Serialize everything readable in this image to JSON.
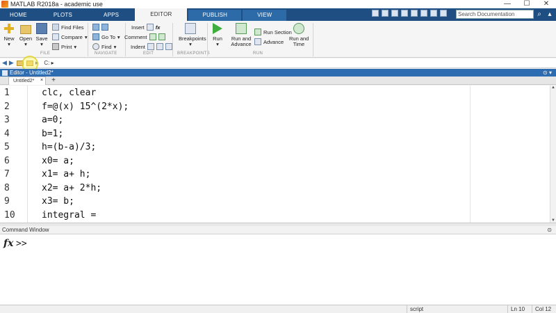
{
  "window": {
    "title": "MATLAB R2018a - academic use",
    "min": "—",
    "max": "☐",
    "close": "✕"
  },
  "tabs": [
    "HOME",
    "PLOTS",
    "APPS",
    "EDITOR",
    "PUBLISH",
    "VIEW"
  ],
  "search": {
    "placeholder": "Search Documentation"
  },
  "ribbon": {
    "new": "New",
    "open": "Open",
    "save": "Save",
    "find_files": "Find Files",
    "compare": "Compare",
    "print": "Print",
    "go_to": "Go To",
    "find": "Find",
    "insert": "Insert",
    "comment": "Comment",
    "indent": "Indent",
    "breakpoints": "Breakpoints",
    "run": "Run",
    "run_advance": "Run and\nAdvance",
    "run_section": "Run Section",
    "advance": "Advance",
    "run_time": "Run and\nTime",
    "sections": {
      "file": "FILE",
      "navigate": "NAVIGATE",
      "edit": "EDIT",
      "breakpoints": "BREAKPOINTS",
      "run": "RUN"
    }
  },
  "address": {
    "path": "C: ▸"
  },
  "editor": {
    "header": "Editor - Untitled2*",
    "tab": "Untitled2*",
    "lines": [
      {
        "no": "1",
        "code": "clc, clear"
      },
      {
        "no": "2",
        "code": "f=@(x) 15^(2*x);"
      },
      {
        "no": "3",
        "code": "a=0;"
      },
      {
        "no": "4",
        "code": "b=1;"
      },
      {
        "no": "5",
        "code": "h=(b-a)/3;"
      },
      {
        "no": "6",
        "code": "x0= a;"
      },
      {
        "no": "7",
        "code": "x1= a+ h;"
      },
      {
        "no": "8",
        "code": "x2= a+ 2*h;"
      },
      {
        "no": "9",
        "code": "x3= b;"
      },
      {
        "no": "10",
        "code": "integral ="
      }
    ]
  },
  "command_window": {
    "title": "Command Window",
    "prompt": ">>",
    "fx": "fx"
  },
  "status": {
    "mode": "script",
    "ln": "Ln  10",
    "col": "Col  12"
  },
  "colors": {
    "tab_bar": "#1f4f82",
    "editor_header": "#2e6cb1"
  }
}
